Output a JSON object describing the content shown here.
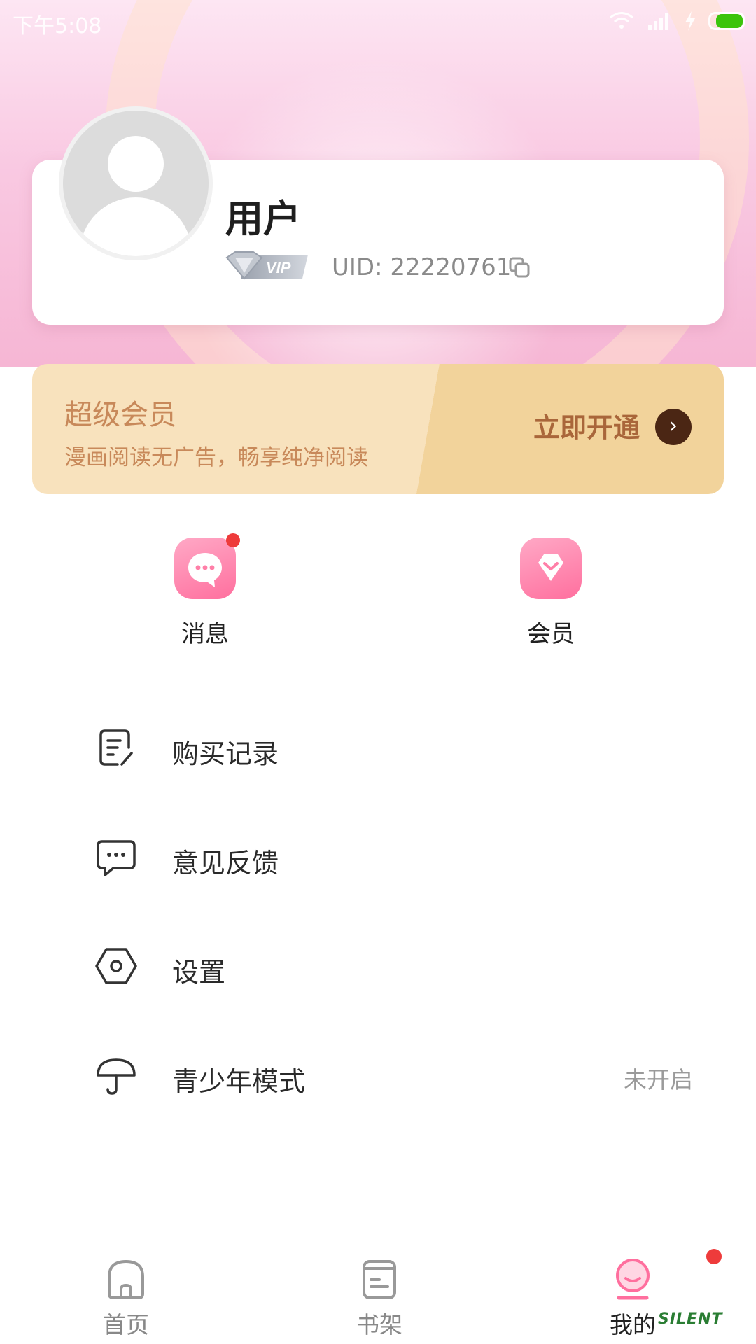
{
  "status_bar": {
    "time": "下午5:08"
  },
  "profile": {
    "name": "用户",
    "vip_badge": "VIP",
    "uid": "UID: 22220761"
  },
  "vip_banner": {
    "title": "超级会员",
    "subtitle": "漫画阅读无广告，畅享纯净阅读",
    "action": "立即开通",
    "arrow": "›"
  },
  "shortcuts": [
    {
      "label": "消息",
      "icon": "message-icon",
      "has_dot": true
    },
    {
      "label": "会员",
      "icon": "diamond-icon",
      "has_dot": false
    }
  ],
  "menu": [
    {
      "label": "购买记录",
      "icon": "purchase-record-icon",
      "value": ""
    },
    {
      "label": "意见反馈",
      "icon": "feedback-icon",
      "value": ""
    },
    {
      "label": "设置",
      "icon": "settings-icon",
      "value": ""
    },
    {
      "label": "青少年模式",
      "icon": "umbrella-icon",
      "value": "未开启"
    }
  ],
  "tabs": [
    {
      "label": "首页",
      "icon": "home-icon",
      "active": false
    },
    {
      "label": "书架",
      "icon": "bookshelf-icon",
      "active": false
    },
    {
      "label": "我的",
      "icon": "profile-icon",
      "active": true
    }
  ],
  "watermark": "SILENT",
  "colors": {
    "accent_pink": "#ff6f9e",
    "vip_gold": "#c8895a",
    "badge_red": "#ee3b3b",
    "battery_green": "#3bc40b"
  }
}
